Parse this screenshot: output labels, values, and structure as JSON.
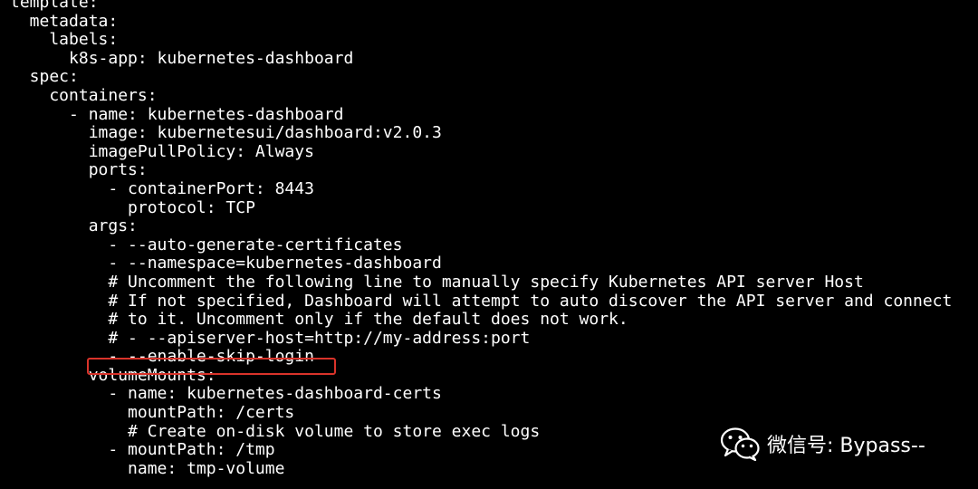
{
  "terminal": {
    "lines": [
      "template:",
      "  metadata:",
      "    labels:",
      "      k8s-app: kubernetes-dashboard",
      "  spec:",
      "    containers:",
      "      - name: kubernetes-dashboard",
      "        image: kubernetesui/dashboard:v2.0.3",
      "        imagePullPolicy: Always",
      "        ports:",
      "          - containerPort: 8443",
      "            protocol: TCP",
      "        args:",
      "          - --auto-generate-certificates",
      "          - --namespace=kubernetes-dashboard",
      "          # Uncomment the following line to manually specify Kubernetes API server Host",
      "          # If not specified, Dashboard will attempt to auto discover the API server and connect",
      "          # to it. Uncomment only if the default does not work.",
      "          # - --apiserver-host=http://my-address:port",
      "          - --enable-skip-login",
      "        volumeMounts:",
      "          - name: kubernetes-dashboard-certs",
      "            mountPath: /certs",
      "            # Create on-disk volume to store exec logs",
      "          - mountPath: /tmp",
      "            name: tmp-volume"
    ]
  },
  "watermark": {
    "text": "微信号: Bypass--",
    "icon": "wechat-icon"
  },
  "colors": {
    "background": "#000000",
    "text": "#ffffff",
    "highlight": "#d9332a"
  }
}
